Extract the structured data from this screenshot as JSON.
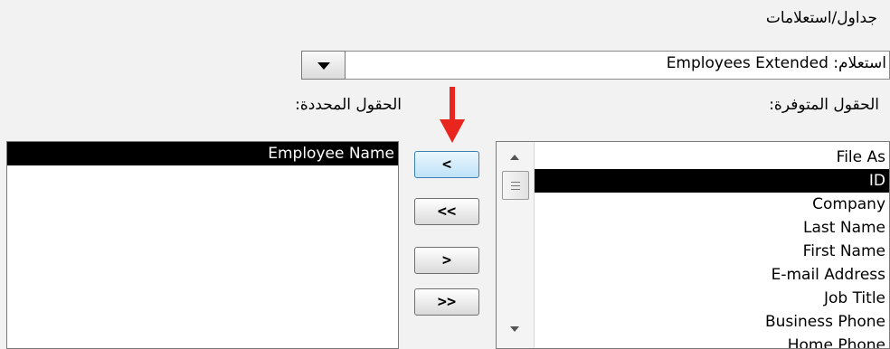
{
  "labels": {
    "tables_queries": "جداول/استعلامات",
    "available_fields": "الحقول المتوفرة:",
    "selected_fields": "الحقول المحددة:"
  },
  "query_combo": {
    "value": "استعلام: Employees Extended"
  },
  "available_fields": [
    "File As",
    "ID",
    "Company",
    "Last Name",
    "First Name",
    "E-mail Address",
    "Job Title",
    "Business Phone",
    "Home Phone"
  ],
  "available_selected_index": 1,
  "selected_fields": [
    "Employee Name"
  ],
  "buttons": {
    "add_one": "<",
    "add_all": "<<",
    "remove_one": ">",
    "remove_all": ">>"
  },
  "icons": {
    "dropdown": "chevron-down-icon",
    "pointer": "red-arrow-down-icon",
    "pointer_color": "#e8261d"
  }
}
